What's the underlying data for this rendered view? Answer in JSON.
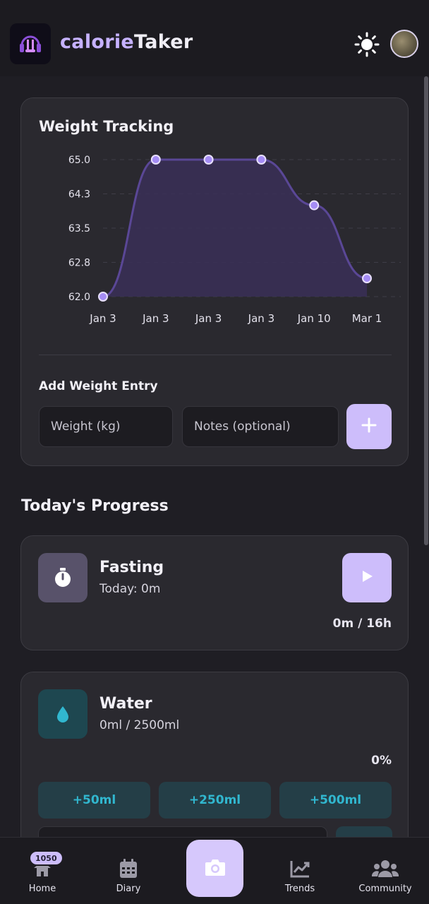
{
  "app": {
    "brand_part1": "calorie",
    "brand_part2": "Taker"
  },
  "header": {
    "logo_icon": "headphones-logo-icon",
    "theme_icon": "sun-icon",
    "avatar_icon": "user-avatar"
  },
  "weight": {
    "title": "Weight Tracking",
    "add_title": "Add Weight Entry",
    "weight_placeholder": "Weight (kg)",
    "notes_placeholder": "Notes (optional)",
    "add_icon": "plus-icon"
  },
  "chart_data": {
    "type": "area",
    "categories": [
      "Jan 3",
      "Jan 3",
      "Jan 3",
      "Jan 3",
      "Jan 10",
      "Mar 1"
    ],
    "values": [
      62.0,
      65.0,
      65.0,
      65.0,
      64.0,
      62.4
    ],
    "y_ticks": [
      "65.0",
      "64.3",
      "63.5",
      "62.8",
      "62.0"
    ],
    "ylim": [
      62.0,
      65.0
    ],
    "grid": true,
    "colors": {
      "line": "#5a4796",
      "fill": "#3a2f57",
      "point": "#a58cf5",
      "point_stroke": "#e8e0ff"
    }
  },
  "progress": {
    "heading": "Today's Progress",
    "fasting": {
      "name": "Fasting",
      "sub": "Today: 0m",
      "progress": "0m / 16h",
      "icon": "stopwatch-icon",
      "action_icon": "play-icon"
    },
    "water": {
      "name": "Water",
      "sub": "0ml / 2500ml",
      "percent": "0%",
      "icon": "water-drop-icon",
      "buttons": [
        "+50ml",
        "+250ml",
        "+500ml"
      ]
    }
  },
  "nav": {
    "home": "Home",
    "home_badge": "1050",
    "diary": "Diary",
    "trends": "Trends",
    "community": "Community",
    "camera_icon": "camera-icon"
  },
  "colors": {
    "accent": "#cdbdfb",
    "background": "#1f1e24",
    "card": "#2a292f",
    "water_accent": "#31b7cf"
  }
}
